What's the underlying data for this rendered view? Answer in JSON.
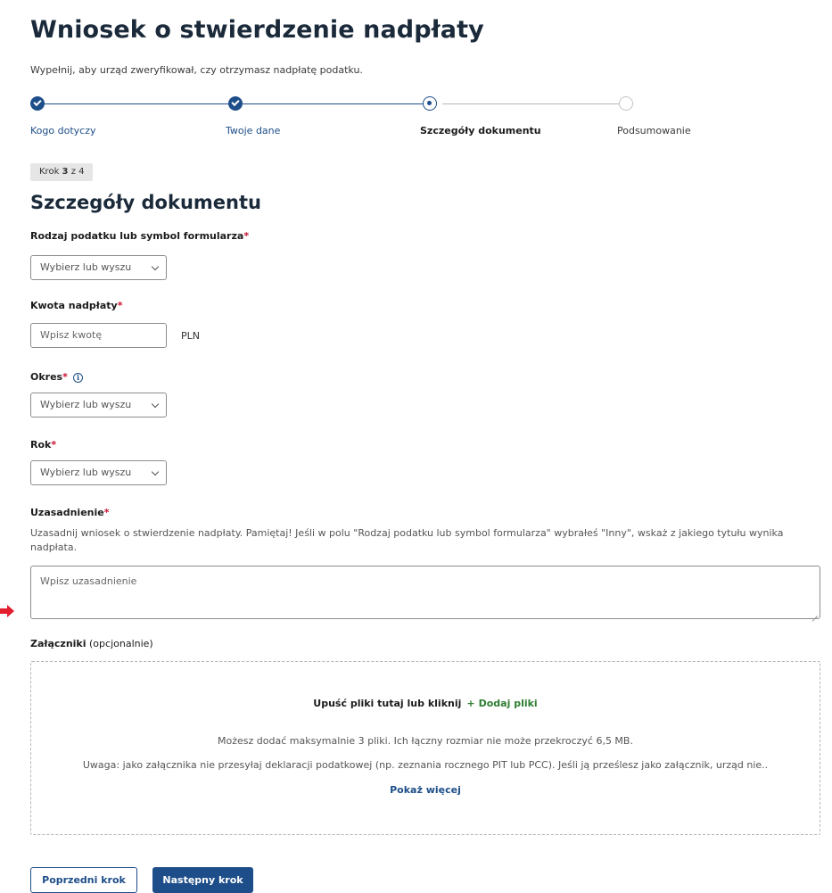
{
  "page": {
    "title": "Wniosek o stwierdzenie nadpłaty",
    "subtitle": "Wypełnij, aby urząd zweryfikował, czy otrzymasz nadpłatę podatku."
  },
  "stepper": {
    "steps": [
      {
        "label": "Kogo dotyczy",
        "state": "done"
      },
      {
        "label": "Twoje dane",
        "state": "done"
      },
      {
        "label": "Szczegóły dokumentu",
        "state": "current"
      },
      {
        "label": "Podsumowanie",
        "state": "todo"
      }
    ]
  },
  "progress_badge": {
    "prefix": "Krok ",
    "current": "3",
    "suffix": " z 4"
  },
  "section": {
    "title": "Szczegóły dokumentu"
  },
  "form": {
    "required_mark": "*",
    "tax_type": {
      "label": "Rodzaj podatku lub symbol formularza",
      "placeholder": "Wybierz lub wyszu"
    },
    "amount": {
      "label": "Kwota nadpłaty",
      "placeholder": "Wpisz kwotę",
      "unit": "PLN"
    },
    "period": {
      "label": "Okres",
      "info_glyph": "i",
      "placeholder": "Wybierz lub wyszu"
    },
    "year": {
      "label": "Rok",
      "placeholder": "Wybierz lub wyszu"
    },
    "justification": {
      "label": "Uzasadnienie",
      "helper": "Uzasadnij wniosek o stwierdzenie nadpłaty. Pamiętaj! Jeśli w polu \"Rodzaj podatku lub symbol formularza\" wybrałeś \"Inny\", wskaż z jakiego tytułu wynika nadpłata.",
      "placeholder": "Wpisz uzasadnienie"
    },
    "attachments": {
      "label": "Załączniki",
      "optional": " (opcjonalnie)",
      "drop_text": "Upuść pliki tutaj  lub kliknij",
      "plus_glyph": "+",
      "add_label": "Dodaj pliki",
      "limits": "Możesz dodać maksymalnie 3 pliki. Ich łączny rozmiar nie może przekroczyć 6,5 MB.",
      "warning": "Uwaga: jako załącznika nie przesyłaj deklaracji podatkowej (np. zeznania rocznego PIT lub PCC). Jeśli ją prześlesz jako załącznik, urząd nie..",
      "show_more": "Pokaż więcej"
    }
  },
  "buttons": {
    "prev": "Poprzedni krok",
    "next": "Następny krok"
  },
  "colors": {
    "primary": "#1d4e89",
    "required": "#c8102e",
    "add_green": "#2e7d32",
    "arrow_red": "#e11d2e"
  }
}
